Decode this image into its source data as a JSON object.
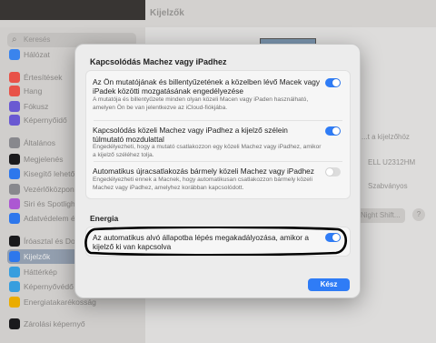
{
  "background": {
    "window_title": "Kijelzők",
    "search_placeholder": "Keresés",
    "sidebar_items": [
      {
        "label": "Hálózat",
        "color": "#3d8af7"
      },
      {
        "label": "Értesítések",
        "color": "#f2564b"
      },
      {
        "label": "Hang",
        "color": "#f2564b"
      },
      {
        "label": "Fókusz",
        "color": "#6f5ddb"
      },
      {
        "label": "Képernyőidő",
        "color": "#6f5ddb"
      },
      {
        "label": "Általános",
        "color": "#8e8e93"
      },
      {
        "label": "Megjelenés",
        "color": "#1c1c1e"
      },
      {
        "label": "Kisegítő lehetős",
        "color": "#2f7cf6"
      },
      {
        "label": "Vezérlőközpont",
        "color": "#8e8e93"
      },
      {
        "label": "Siri és Spotlight",
        "color": "#b45cdb"
      },
      {
        "label": "Adatvédelem és",
        "color": "#2f7cf6"
      },
      {
        "label": "Íróasztal és Dock",
        "color": "#1c1c1e"
      },
      {
        "label": "Kijelzők",
        "color": "#2f7cf6"
      },
      {
        "label": "Háttérkép",
        "color": "#3aa5e8"
      },
      {
        "label": "Képernyővédő",
        "color": "#3aa5e8"
      },
      {
        "label": "Energiatakarékosság",
        "color": "#f4b400"
      },
      {
        "label": "Zárolási képernyő",
        "color": "#1c1c1e"
      }
    ],
    "right_fragments": {
      "row1": "...t a kijelzőhöz",
      "row2": "ELL U2312HM",
      "row3": "Szabványos",
      "night_shift": "Night Shift...",
      "help": "?"
    }
  },
  "sheet": {
    "title": "Kapcsolódás Machez vagy iPadhez",
    "group1": [
      {
        "title": "Az Ön mutatójának és billentyűzetének a közelben lévő Macek vagy iPadek közötti mozgatásának engedélyezése",
        "desc": "A mutatója és billentyűzete minden olyan közeli Macen vagy iPaden használható, amelyen Ön be van jelentkezve az iCloud-fiókjába.",
        "enabled": true
      },
      {
        "title": "Kapcsolódás közeli Machez vagy iPadhez a kijelző szélein túlmutató mozdulattal",
        "desc": "Engedélyezheti, hogy a mutató csatlakozzon egy közeli Machez vagy iPadhez, amikor a kijelző széléhez tolja.",
        "enabled": true
      },
      {
        "title": "Automatikus újracsatlakozás bármely közeli Machez vagy iPadhez",
        "desc": "Engedélyezheti ennek a Macnek, hogy automatikusan csatlakozzon bármely közeli Machez vagy iPadhez, amelyhez korábban kapcsolódott.",
        "enabled": false
      }
    ],
    "energy_section_title": "Energia",
    "energy_row": {
      "title": "Az automatikus alvó állapotba lépés megakadályozása, amikor a kijelző ki van kapcsolva",
      "enabled": true
    },
    "done_label": "Kész"
  }
}
